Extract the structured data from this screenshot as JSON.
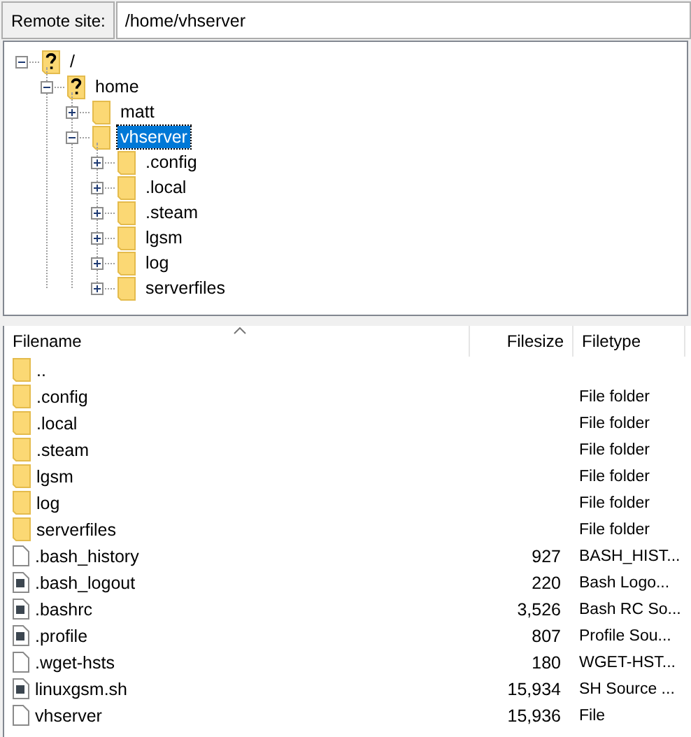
{
  "remote_site": {
    "label": "Remote site:",
    "value": "/home/vhserver"
  },
  "tree": [
    {
      "label": "/",
      "kind": "unknown",
      "expanded": true,
      "selected": false,
      "children": [
        {
          "label": "home",
          "kind": "unknown",
          "expanded": true,
          "selected": false,
          "children": [
            {
              "label": "matt",
              "kind": "folder",
              "expanded": false,
              "selected": false
            },
            {
              "label": "vhserver",
              "kind": "folder",
              "expanded": true,
              "selected": true,
              "children": [
                {
                  "label": ".config",
                  "kind": "folder",
                  "expanded": false,
                  "selected": false
                },
                {
                  "label": ".local",
                  "kind": "folder",
                  "expanded": false,
                  "selected": false
                },
                {
                  "label": ".steam",
                  "kind": "folder",
                  "expanded": false,
                  "selected": false
                },
                {
                  "label": "lgsm",
                  "kind": "folder",
                  "expanded": false,
                  "selected": false
                },
                {
                  "label": "log",
                  "kind": "folder",
                  "expanded": false,
                  "selected": false
                },
                {
                  "label": "serverfiles",
                  "kind": "folder",
                  "expanded": false,
                  "selected": false
                }
              ]
            }
          ]
        }
      ]
    }
  ],
  "file_list": {
    "columns": [
      "Filename",
      "Filesize",
      "Filetype"
    ],
    "rows": [
      {
        "kind": "folder",
        "name": ".."
      },
      {
        "kind": "folder",
        "name": ".config",
        "type": "File folder"
      },
      {
        "kind": "folder",
        "name": ".local",
        "type": "File folder"
      },
      {
        "kind": "folder",
        "name": ".steam",
        "type": "File folder"
      },
      {
        "kind": "folder",
        "name": "lgsm",
        "type": "File folder"
      },
      {
        "kind": "folder",
        "name": "log",
        "type": "File folder"
      },
      {
        "kind": "folder",
        "name": "serverfiles",
        "type": "File folder"
      },
      {
        "kind": "file",
        "name": ".bash_history",
        "size": "927",
        "type": "BASH_HIST..."
      },
      {
        "kind": "script",
        "name": ".bash_logout",
        "size": "220",
        "type": "Bash Logo..."
      },
      {
        "kind": "script",
        "name": ".bashrc",
        "size": "3,526",
        "type": "Bash RC So..."
      },
      {
        "kind": "script",
        "name": ".profile",
        "size": "807",
        "type": "Profile Sou..."
      },
      {
        "kind": "file",
        "name": ".wget-hsts",
        "size": "180",
        "type": "WGET-HST..."
      },
      {
        "kind": "script",
        "name": "linuxgsm.sh",
        "size": "15,934",
        "type": "SH Source ..."
      },
      {
        "kind": "file",
        "name": "vhserver",
        "size": "15,936",
        "type": "File"
      }
    ]
  }
}
